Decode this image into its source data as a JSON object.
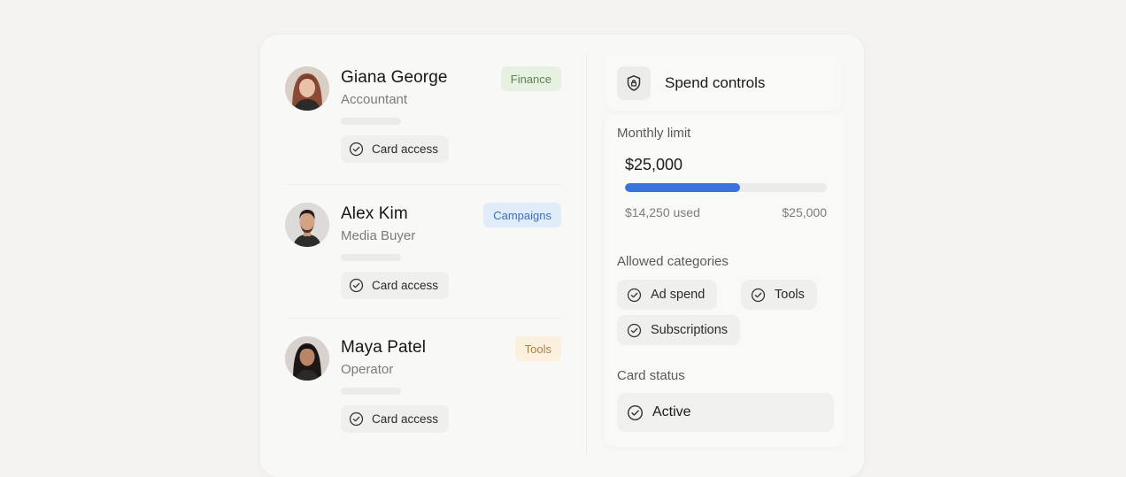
{
  "people": [
    {
      "name": "Giana George",
      "role": "Accountant",
      "tag": "Finance",
      "chip": "Card access"
    },
    {
      "name": "Alex Kim",
      "role": "Media Buyer",
      "tag": "Campaigns",
      "chip": "Card access"
    },
    {
      "name": "Maya Patel",
      "role": "Operator",
      "tag": "Tools",
      "chip": "Card access"
    }
  ],
  "panel": {
    "title": "Spend controls",
    "icon": "shield-lock-icon",
    "monthly_limit": {
      "label": "Monthly limit",
      "amount": "$25,000",
      "used_label": "$14,250 used",
      "total_label": "$25,000",
      "progress_fraction": 0.57
    },
    "allowed_categories": {
      "label": "Allowed categories",
      "items": [
        "Ad spend",
        "Tools",
        "Subscriptions"
      ]
    },
    "card_status": {
      "label": "Card status",
      "value": "Active"
    }
  },
  "colors": {
    "accent": "#3b73de",
    "finance_bg": "#e7f1e1",
    "campaigns_bg": "#e1ecfa",
    "tools_bg": "#fbf0dd"
  }
}
